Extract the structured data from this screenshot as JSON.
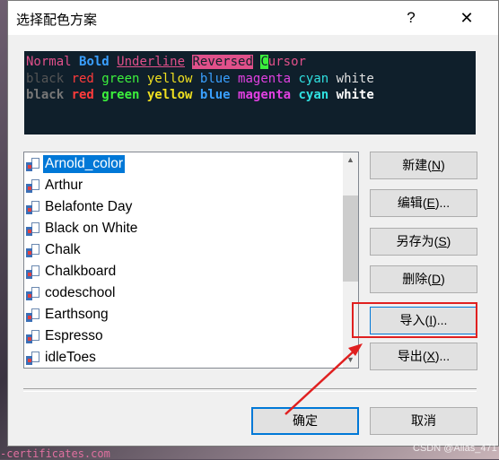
{
  "dialog": {
    "title": "选择配色方案",
    "help_label": "?",
    "close_label": "✕"
  },
  "preview": {
    "line1": [
      {
        "text": "Normal ",
        "color": "#e0508a",
        "style": ""
      },
      {
        "text": "Bold ",
        "color": "#3aa0ff",
        "style": "bold"
      },
      {
        "text": "Underline",
        "color": "#e0508a",
        "style": "underline"
      },
      {
        "text": " ",
        "color": "#e0508a",
        "style": ""
      },
      {
        "text": "Reversed",
        "color": "#0f1f2b",
        "style": "reversed"
      },
      {
        "text": " ",
        "color": "#e0508a",
        "style": ""
      },
      {
        "text": "C",
        "color": "#0f1f2b",
        "style": "cursor"
      },
      {
        "text": "ursor",
        "color": "#e0508a",
        "style": ""
      }
    ],
    "line2": [
      {
        "text": "black ",
        "color": "#555555"
      },
      {
        "text": "red ",
        "color": "#ff3b3b"
      },
      {
        "text": "green ",
        "color": "#3cf03c"
      },
      {
        "text": "yellow ",
        "color": "#f0e020"
      },
      {
        "text": "blue ",
        "color": "#3aa0ff"
      },
      {
        "text": "magenta ",
        "color": "#e040e0"
      },
      {
        "text": "cyan ",
        "color": "#30e0e0"
      },
      {
        "text": "white",
        "color": "#e0e0e0"
      }
    ],
    "line3": [
      {
        "text": "black ",
        "color": "#777777"
      },
      {
        "text": "red ",
        "color": "#ff3b3b"
      },
      {
        "text": "green ",
        "color": "#3cf03c"
      },
      {
        "text": "yellow ",
        "color": "#f0e020"
      },
      {
        "text": "blue ",
        "color": "#3aa0ff"
      },
      {
        "text": "magenta ",
        "color": "#e040e0"
      },
      {
        "text": "cyan ",
        "color": "#30e0e0"
      },
      {
        "text": "white",
        "color": "#ffffff"
      }
    ]
  },
  "schemes": {
    "items": [
      "Arnold_color",
      "Arthur",
      "Belafonte Day",
      "Black on White",
      "Chalk",
      "Chalkboard",
      "codeschool",
      "Earthsong",
      "Espresso",
      "idleToes"
    ],
    "selected": "Arnold_color"
  },
  "buttons": {
    "new_label": "新建",
    "new_key": "N",
    "edit_label": "编辑",
    "edit_key": "E",
    "saveas_label": "另存为",
    "saveas_key": "S",
    "delete_label": "删除",
    "delete_key": "D",
    "import_label": "导入",
    "import_key": "I",
    "export_label": "导出",
    "export_key": "X",
    "ok_label": "确定",
    "cancel_label": "取消",
    "ellipsis": "..."
  },
  "watermark": {
    "left": "-certificates.com",
    "right": "CSDN @Alias_471"
  },
  "colors": {
    "annotation_red": "#e02020",
    "selection_blue": "#0078d7",
    "preview_bg": "#0f1f2b"
  }
}
